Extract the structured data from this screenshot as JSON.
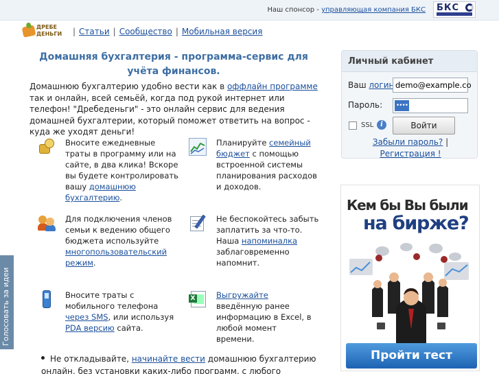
{
  "sponsor": {
    "prefix": "Наш спонсор - ",
    "link": "управляющая компания БКС",
    "logo_text": "БКС"
  },
  "logo": {
    "text": "ДРЕБЕ ДЕНЬГИ"
  },
  "nav": {
    "items": [
      "Статьи",
      "Сообщество",
      "Мобильная версия"
    ],
    "separator": "|"
  },
  "main": {
    "title": "Домашняя бухгалтерия - программа-сервис для учёта финансов.",
    "intro_before": "Домашнюю бухгалтерию удобно вести как в ",
    "intro_link": "оффлайн программе",
    "intro_after": " так и онлайн, всей семьёй, когда под рукой интернет или телефон! \"Дребеденьги\" - это онлайн сервис для ведения домашней бухгалтерии, который поможет ответить на вопрос - куда же уходят деньги!"
  },
  "features": [
    {
      "icon": "coins-icon",
      "before": "Вносите ежедневные траты в программу или на сайте, в два клика! Вскоре вы будете контролировать вашу ",
      "link": "домашнюю бухгалтерию",
      "after": "."
    },
    {
      "icon": "chart-icon",
      "before": "Планируйте ",
      "link": "семейный бюджет",
      "after": " с помощью встроенной системы планирования расходов и доходов."
    },
    {
      "icon": "users-icon",
      "before": "Для подключения членов семьи к ведению общего бюджета используйте ",
      "link": "многопользовательский режим",
      "after": "."
    },
    {
      "icon": "note-icon",
      "before": "Не беспокойтесь забыть заплатить за что-то. Наша ",
      "link": "напоминалка",
      "after": " заблаговременно напомнит."
    },
    {
      "icon": "phone-icon",
      "before": "Вносите траты с мобильного телефона ",
      "link": "через SMS",
      "middle": ", или используя ",
      "link2": "PDA версию",
      "after": " сайта."
    },
    {
      "icon": "excel-icon",
      "before": "",
      "link": "Выгружайте",
      "after": " введённую ранее информацию в Excel, в любой момент времени."
    }
  ],
  "bullet": {
    "before": "Не откладывайте, ",
    "link": "начинайте вести",
    "after": " домашнюю бухгалтерию онлайн, без установки каких-либо программ, с любого компьютера или"
  },
  "vote_tab": "Голосовать за идеи",
  "cabinet": {
    "title": "Личный кабинет",
    "login_prefix": "Ваш ",
    "login_link": "логин",
    "login_suffix": ":",
    "login_value": "demo@example.co",
    "password_label": "Пароль:",
    "password_mask": "••••",
    "ssl_label": "SSL",
    "info_icon": "i",
    "submit": "Войти",
    "forgot": "Забыли пароль?",
    "sep": "|",
    "register": "Регистрация !"
  },
  "banner": {
    "line1": "Кем бы Вы были",
    "line2": "на бирже?",
    "button": "Пройти тест"
  }
}
